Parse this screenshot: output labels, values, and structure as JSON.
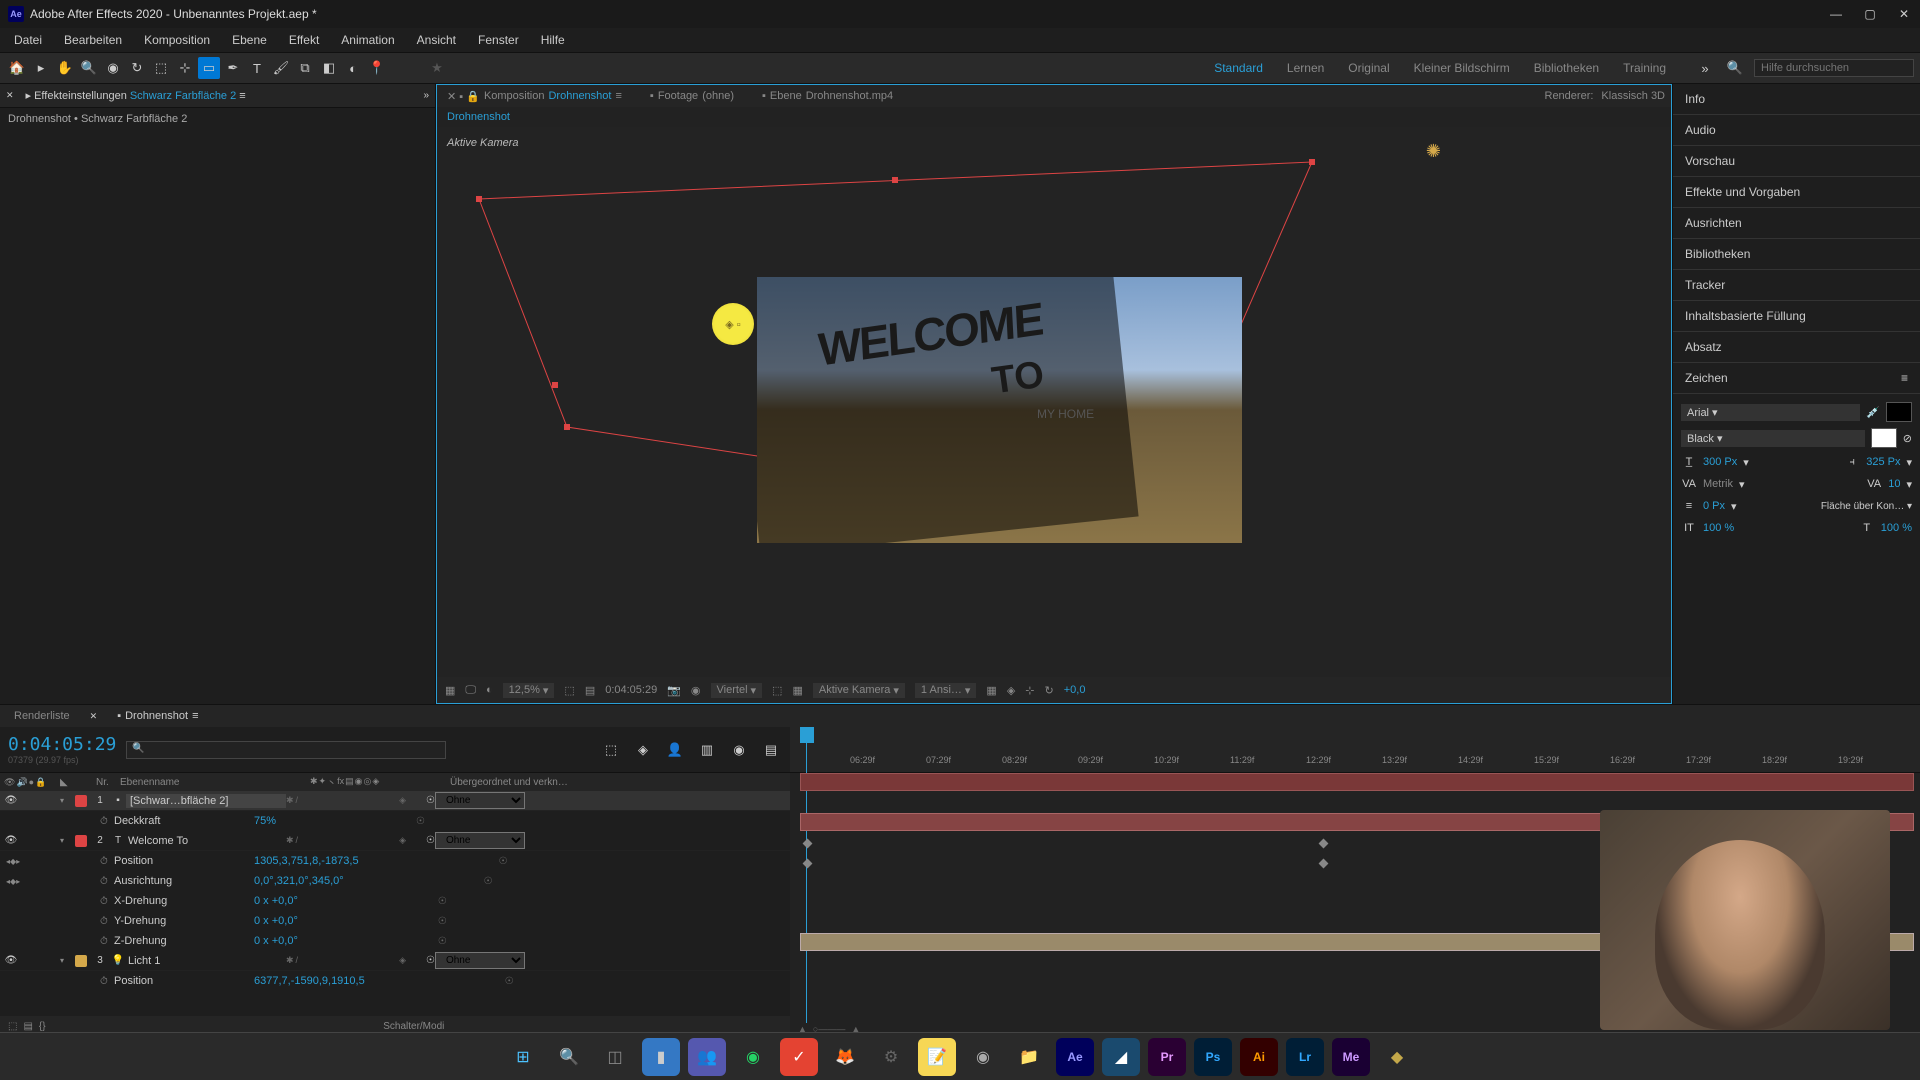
{
  "titlebar": {
    "title": "Adobe After Effects 2020 - Unbenanntes Projekt.aep *"
  },
  "menu": [
    "Datei",
    "Bearbeiten",
    "Komposition",
    "Ebene",
    "Effekt",
    "Animation",
    "Ansicht",
    "Fenster",
    "Hilfe"
  ],
  "workspaces": [
    "Standard",
    "Lernen",
    "Original",
    "Kleiner Bildschirm",
    "Bibliotheken",
    "Training"
  ],
  "search_placeholder": "Hilfe durchsuchen",
  "effect_panel": {
    "tab_label": "Effekteinstellungen",
    "target": "Schwarz Farbfläche 2",
    "sub": "Drohnenshot • Schwarz Farbfläche 2"
  },
  "comp": {
    "tabs": [
      {
        "prefix": "Komposition",
        "name": "Drohnenshot",
        "active": true
      },
      {
        "prefix": "Footage",
        "name": "(ohne)"
      },
      {
        "prefix": "Ebene",
        "name": "Drohnenshot.mp4"
      }
    ],
    "renderer_label": "Renderer:",
    "renderer_value": "Klassisch 3D",
    "breadcrumb": "Drohnenshot"
  },
  "viewport": {
    "camera_label": "Aktive Kamera",
    "text_big1": "WELCOME",
    "text_big2": "TO",
    "text_small": "MY HOME"
  },
  "viewport_footer": {
    "zoom": "12,5%",
    "time": "0:04:05:29",
    "res": "Viertel",
    "camera": "Aktive Kamera",
    "views": "1 Ansi…",
    "exposure": "+0,0"
  },
  "right_panels": [
    "Info",
    "Audio",
    "Vorschau",
    "Effekte und Vorgaben",
    "Ausrichten",
    "Bibliotheken",
    "Tracker",
    "Inhaltsbasierte Füllung",
    "Absatz",
    "Zeichen"
  ],
  "char": {
    "font": "Arial",
    "style": "Black",
    "size": "300 Px",
    "leading": "325 Px",
    "kerning": "Metrik",
    "tracking": "10",
    "stroke": "0 Px",
    "stroke_opt": "Fläche über Kon…",
    "hscale": "100 %",
    "vscale": "100 %"
  },
  "timeline": {
    "tabs": [
      "Renderliste",
      "Drohnenshot"
    ],
    "timecode": "0:04:05:29",
    "timecode_sub": "07379 (29.97 fps)",
    "col_idx": "Nr.",
    "col_name": "Ebenenname",
    "col_parent": "Übergeordnet und verkn…",
    "ticks": [
      "06:29f",
      "07:29f",
      "08:29f",
      "09:29f",
      "10:29f",
      "11:29f",
      "12:29f",
      "13:29f",
      "14:29f",
      "15:29f",
      "16:29f",
      "17:29f",
      "18:29f",
      "19:29f"
    ],
    "none": "Ohne",
    "layers": [
      {
        "idx": "1",
        "color": "#d44",
        "name": "[Schwar…bfläche 2]",
        "type": "solid",
        "boxed": true,
        "props": [
          {
            "name": "Deckkraft",
            "val": "75%"
          }
        ]
      },
      {
        "idx": "2",
        "color": "#d44",
        "name": "Welcome To",
        "type": "text",
        "props": [
          {
            "name": "Position",
            "val": "1305,3,751,8,-1873,5",
            "kf": true
          },
          {
            "name": "Ausrichtung",
            "val": "0,0°,321,0°,345,0°",
            "kf": true
          },
          {
            "name": "X-Drehung",
            "val": "0 x +0,0°"
          },
          {
            "name": "Y-Drehung",
            "val": "0 x +0,0°"
          },
          {
            "name": "Z-Drehung",
            "val": "0 x +0,0°"
          }
        ]
      },
      {
        "idx": "3",
        "color": "#d4a84a",
        "name": "Licht 1",
        "type": "light",
        "props": [
          {
            "name": "Position",
            "val": "6377,7,-1590,9,1910,5"
          }
        ]
      }
    ],
    "footer": "Schalter/Modi"
  },
  "colors": {
    "accent": "#2a9fd6",
    "red": "#d44444",
    "amber": "#d4a84a"
  }
}
